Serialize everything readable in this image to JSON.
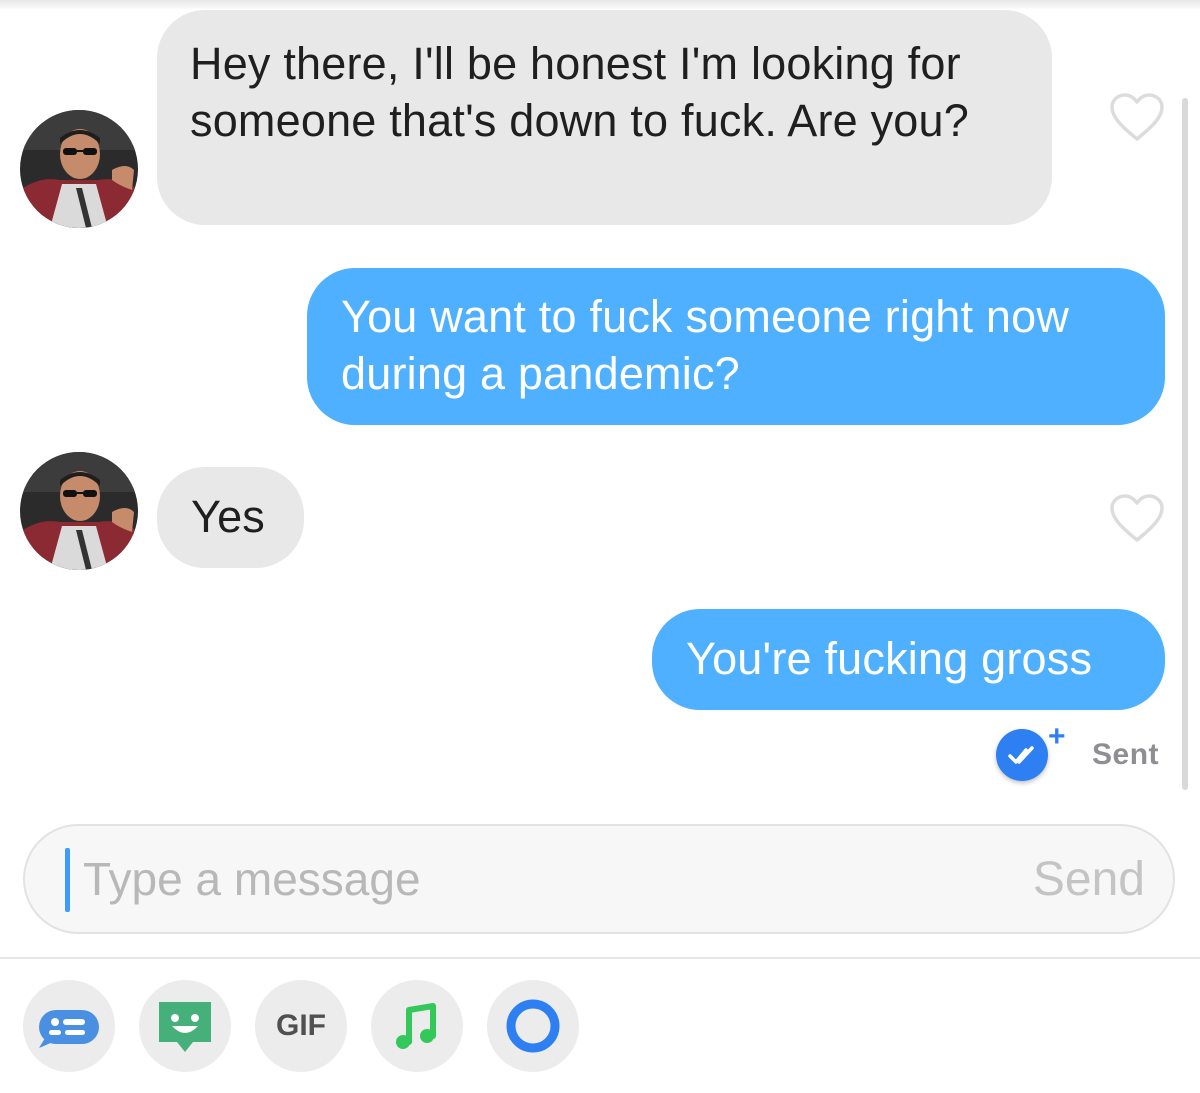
{
  "conversation": {
    "messages": [
      {
        "direction": "incoming",
        "text": "Hey there, I'll be honest I'm looking for someone that's down to fuck. Are you?"
      },
      {
        "direction": "outgoing",
        "text": "You want to fuck someone right now during a pandemic?"
      },
      {
        "direction": "incoming",
        "text": "Yes"
      },
      {
        "direction": "outgoing",
        "text": "You're fucking gross"
      }
    ],
    "status": {
      "label": "Sent",
      "plus": "+",
      "icon": "read-receipt-check-icon"
    }
  },
  "composer": {
    "placeholder": "Type a message",
    "value": "",
    "send_label": "Send"
  },
  "toolbar": {
    "items": [
      {
        "icon": "chat-card-icon",
        "color": "#4a90e2"
      },
      {
        "icon": "bitmoji-face-icon",
        "color": "#45b07a"
      },
      {
        "icon": "gif-icon",
        "label": "GIF",
        "color": "#505050"
      },
      {
        "icon": "music-note-icon",
        "color": "#34c759"
      },
      {
        "icon": "loop-circle-icon",
        "color": "#2e7ff2"
      }
    ]
  },
  "colors": {
    "incoming_bubble": "#e8e8e8",
    "outgoing_bubble": "#4fb0ff",
    "accent": "#2e7ff2"
  }
}
